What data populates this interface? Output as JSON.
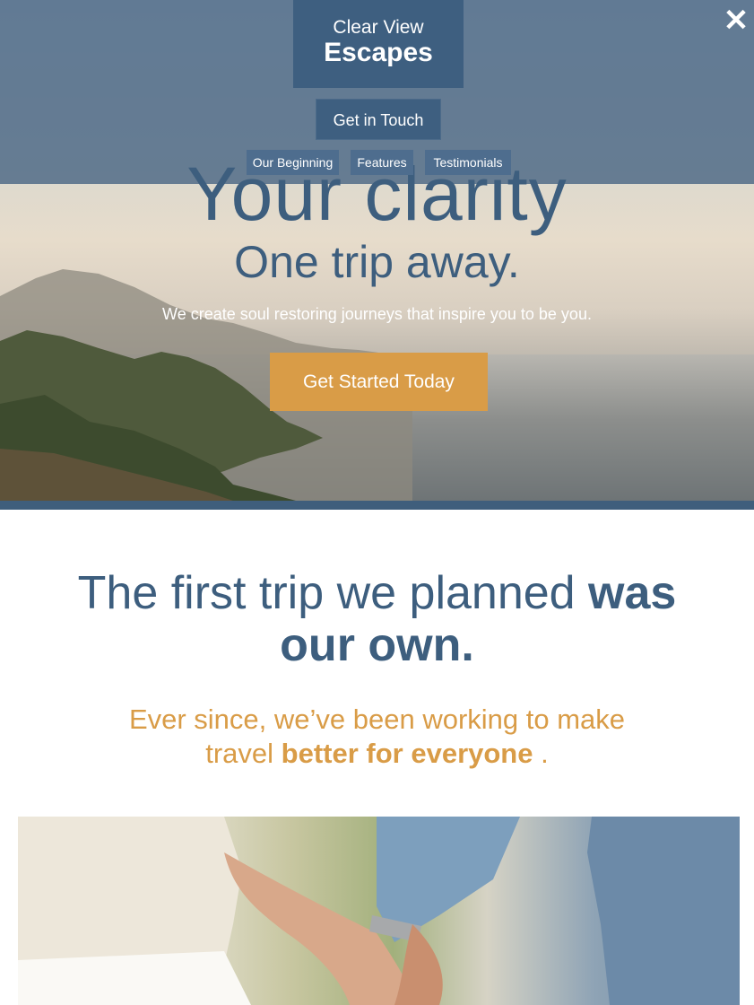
{
  "brand": {
    "line1": "Clear View",
    "line2": "Escapes"
  },
  "header": {
    "contact_label": "Get in Touch",
    "nav": [
      "Our Beginning",
      "Features",
      "Testimonials"
    ],
    "close_icon": "close-icon"
  },
  "hero": {
    "title": "Your clarity",
    "subtitle": "One trip away.",
    "tagline": "We create soul restoring journeys that inspire you to be you.",
    "cta_label": "Get Started Today"
  },
  "story": {
    "heading_light": "The first trip we planned ",
    "heading_bold": "was our own.",
    "sub_light": "Ever since, we’ve been working to make travel ",
    "sub_bold": "better for everyone",
    "sub_end": " ."
  },
  "colors": {
    "brand_blue": "#3e5f80",
    "accent_orange": "#d99c47"
  }
}
